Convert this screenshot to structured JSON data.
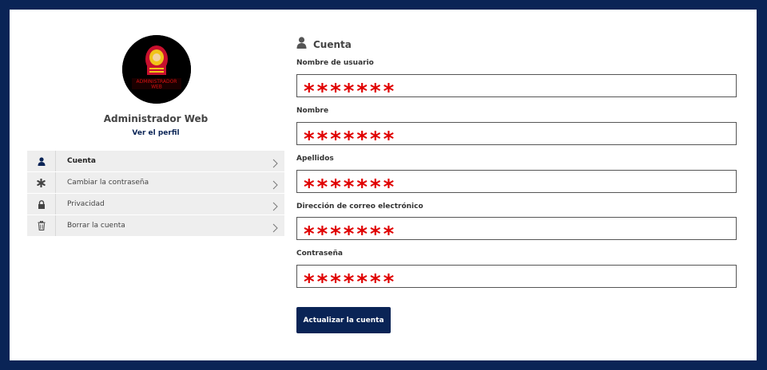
{
  "profile": {
    "name": "Administrador Web",
    "link_label": "Ver el perfil",
    "logo_text_line1": "ADMINISTRADOR",
    "logo_text_line2": "WEB"
  },
  "menu": {
    "items": [
      {
        "label": "Cuenta",
        "icon": "user-icon",
        "active": true
      },
      {
        "label": "Cambiar la contraseña",
        "icon": "asterisk-icon",
        "active": false
      },
      {
        "label": "Privacidad",
        "icon": "lock-icon",
        "active": false
      },
      {
        "label": "Borrar la cuenta",
        "icon": "trash-icon",
        "active": false
      }
    ]
  },
  "account": {
    "title": "Cuenta",
    "fields": [
      {
        "label": "Nombre de usuario",
        "value": "*******"
      },
      {
        "label": "Nombre",
        "value": "*******"
      },
      {
        "label": "Apellidos",
        "value": "*******"
      },
      {
        "label": "Dirección de correo electrónico",
        "value": "*******"
      },
      {
        "label": "Contraseña",
        "value": "*******"
      }
    ],
    "submit_label": "Actualizar la cuenta"
  },
  "colors": {
    "brand": "#0a2456",
    "mask": "#e00000",
    "menu_bg": "#eeeeee"
  }
}
